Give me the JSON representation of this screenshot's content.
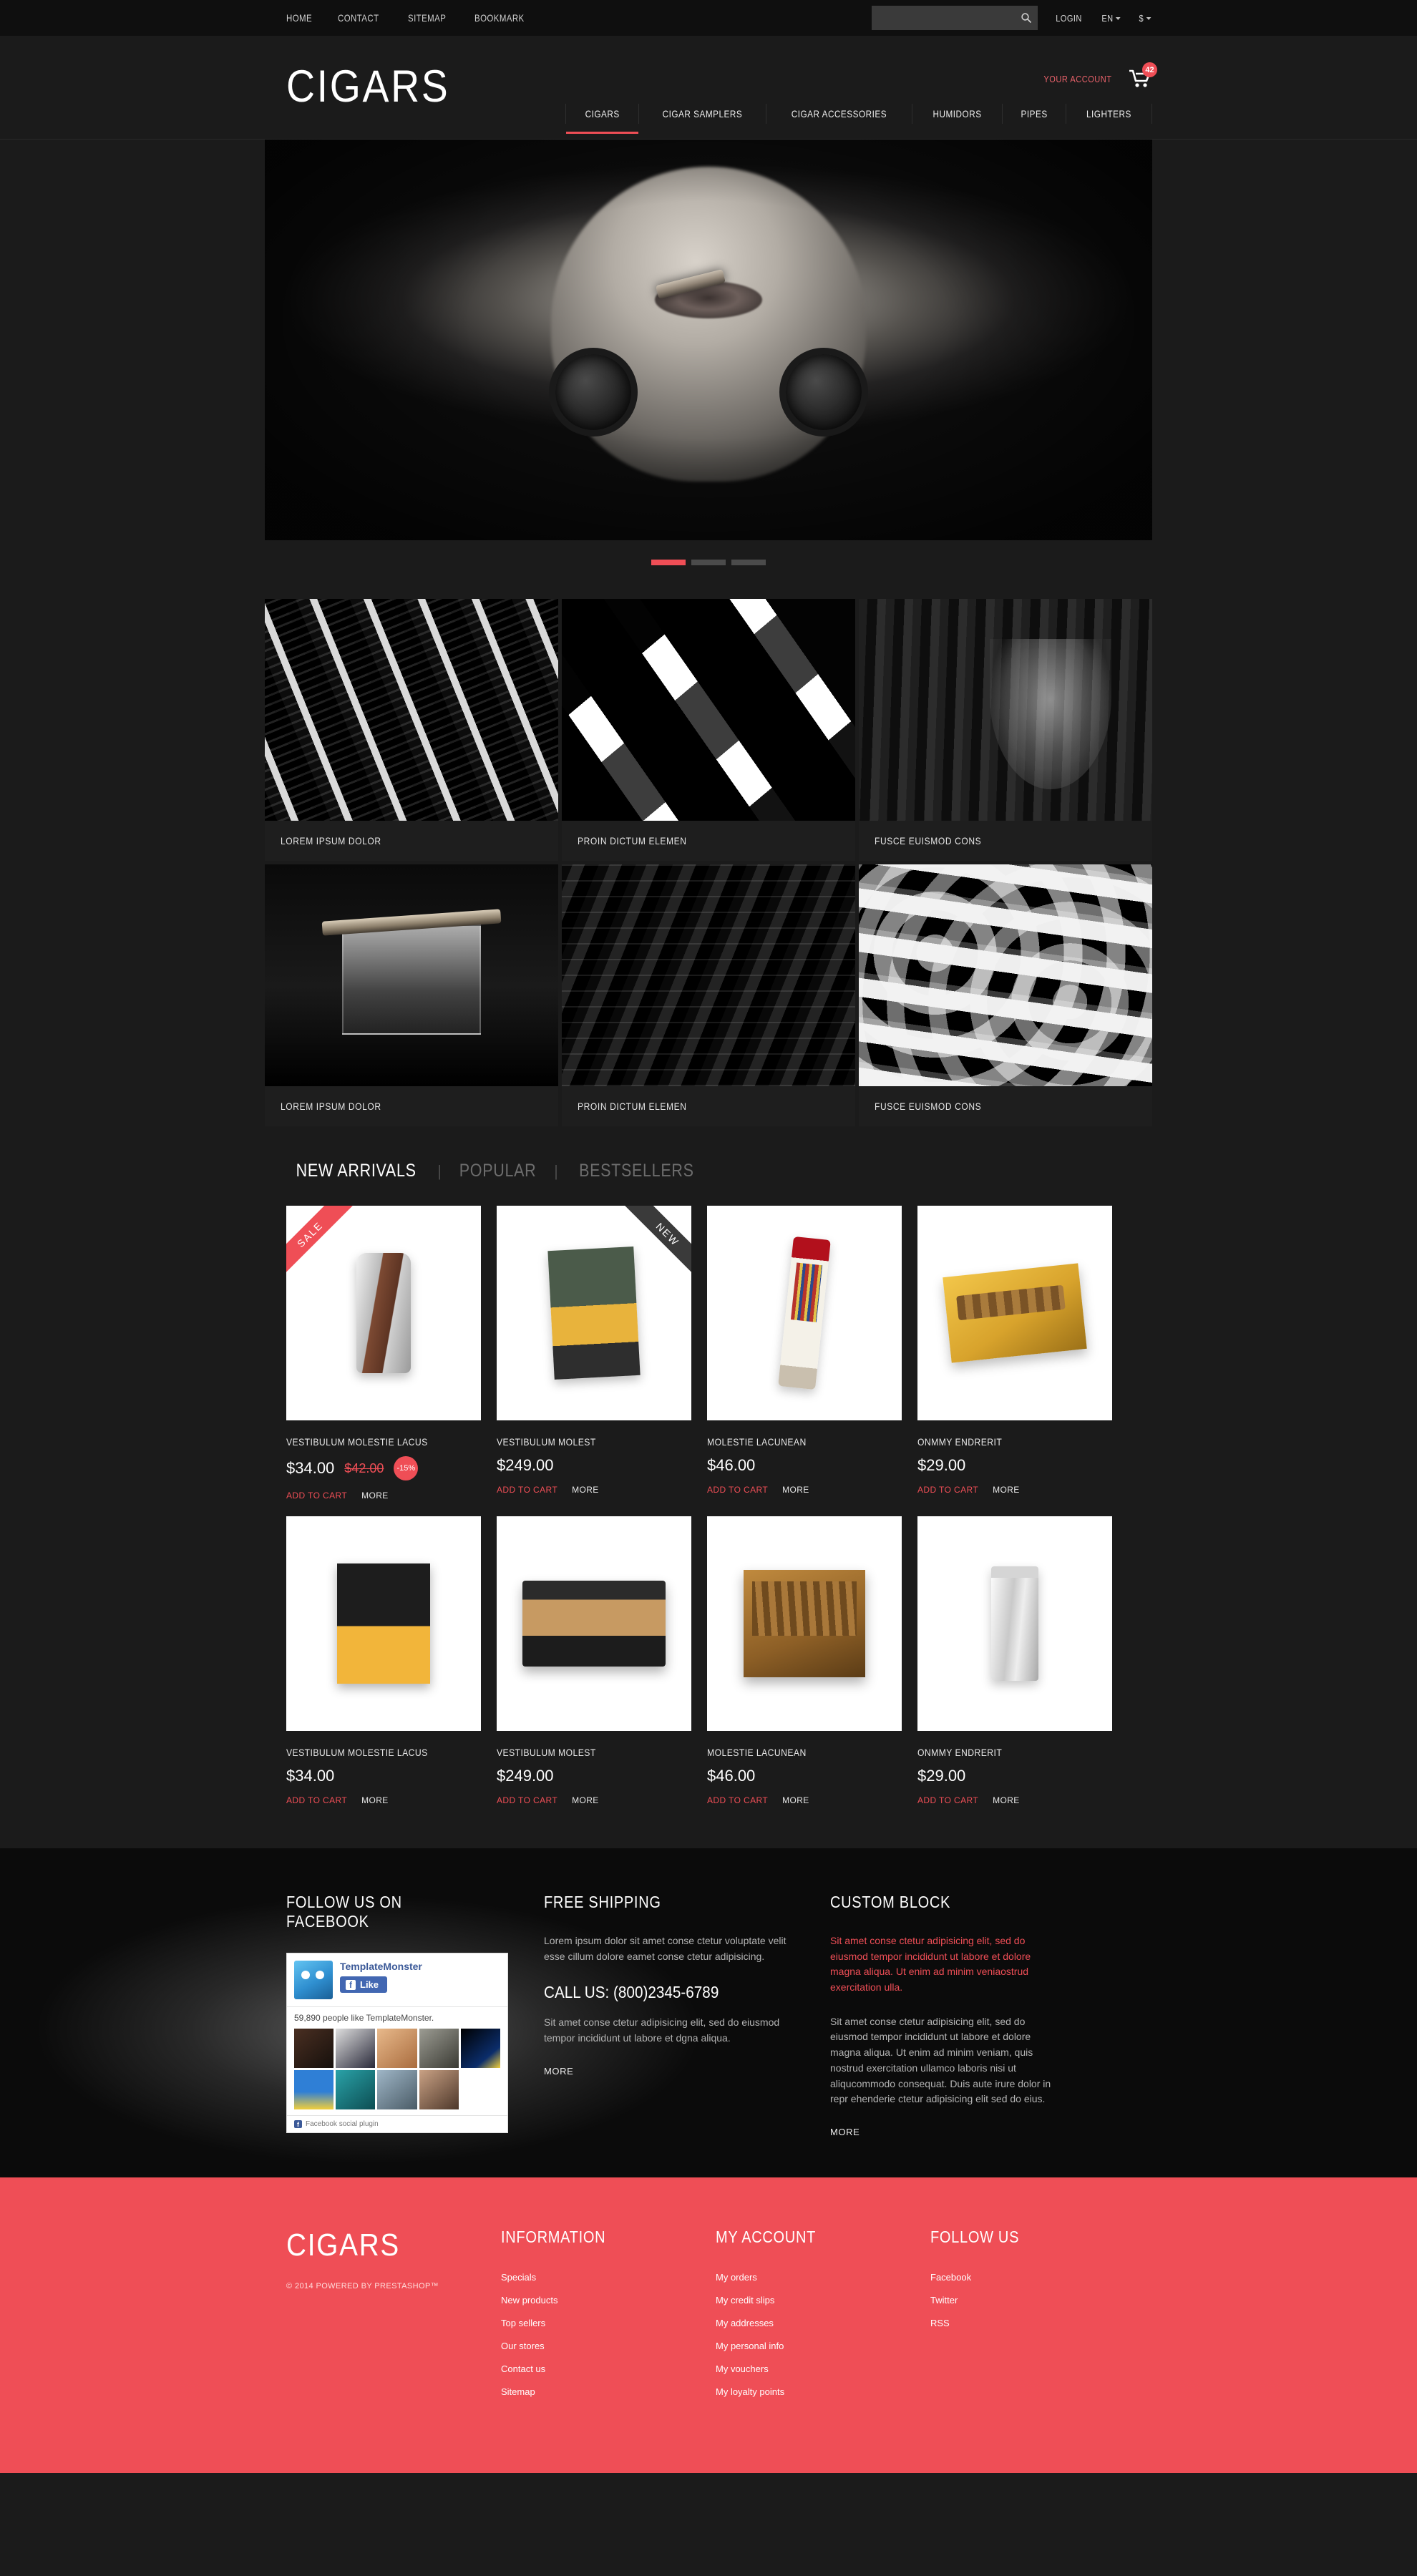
{
  "colors": {
    "accent": "#ef4e56",
    "dark": "#1b1b1b",
    "darker": "#0f0f0f"
  },
  "topbar": {
    "links": [
      "HOME",
      "CONTACT",
      "SITEMAP",
      "BOOKMARK"
    ],
    "search_placeholder": "",
    "search_value": "",
    "login_label": "LOGIN",
    "language_label": "EN",
    "currency_label": "$"
  },
  "header": {
    "logo": "CIGARS",
    "account_label": "YOUR ACCOUNT",
    "cart_count": "42",
    "nav": [
      {
        "label": "CIGARS",
        "active": true
      },
      {
        "label": "CIGAR SAMPLERS",
        "active": false
      },
      {
        "label": "CIGAR ACCESSORIES",
        "active": false
      },
      {
        "label": "HUMIDORS",
        "active": false
      },
      {
        "label": "PIPES",
        "active": false
      },
      {
        "label": "LIGHTERS",
        "active": false
      }
    ]
  },
  "slider": {
    "slides": 3,
    "active_index": 0
  },
  "categories": [
    {
      "caption": "LOREM IPSUM DOLOR",
      "art": "ph-bands"
    },
    {
      "caption": "PROIN DICTUM ELEMEN",
      "art": "ph-scatter"
    },
    {
      "caption": "FUSCE EUISMOD CONS",
      "art": "ph-glass"
    },
    {
      "caption": "LOREM IPSUM DOLOR",
      "art": "ph-whisky"
    },
    {
      "caption": "PROIN DICTUM ELEMEN",
      "art": "ph-smoke"
    },
    {
      "caption": "FUSCE EUISMOD CONS",
      "art": "ph-labels"
    }
  ],
  "products_section": {
    "tabs": [
      {
        "label": "NEW ARRIVALS",
        "active": true
      },
      {
        "label": "POPULAR",
        "active": false
      },
      {
        "label": "BESTSELLERS",
        "active": false
      }
    ],
    "separator": "|",
    "add_to_cart_label": "ADD TO CART",
    "more_label": "MORE",
    "items": [
      {
        "name": "VESTIBULUM MOLESTIE LACUS",
        "price": "$34.00",
        "old_price": "$42.00",
        "discount": "-15%",
        "badge": "SALE",
        "badge_side": "left",
        "art": "pp-lighter1"
      },
      {
        "name": "VESTIBULUM MOLEST",
        "price": "$249.00",
        "old_price": "",
        "discount": "",
        "badge": "NEW",
        "badge_side": "right",
        "art": "pp-box-green"
      },
      {
        "name": "MOLESTIE LACUNEAN",
        "price": "$46.00",
        "old_price": "",
        "discount": "",
        "badge": "",
        "badge_side": "",
        "art": "pp-tube"
      },
      {
        "name": "ONMMY ENDRERIT",
        "price": "$29.00",
        "old_price": "",
        "discount": "",
        "badge": "",
        "badge_side": "",
        "art": "pp-goldbox"
      },
      {
        "name": "VESTIBULUM MOLESTIE LACUS",
        "price": "$34.00",
        "old_price": "",
        "discount": "",
        "badge": "",
        "badge_side": "",
        "art": "pp-darkbox"
      },
      {
        "name": "VESTIBULUM MOLEST",
        "price": "$249.00",
        "old_price": "",
        "discount": "",
        "badge": "",
        "badge_side": "",
        "art": "pp-humidor"
      },
      {
        "name": "MOLESTIE LACUNEAN",
        "price": "$46.00",
        "old_price": "",
        "discount": "",
        "badge": "",
        "badge_side": "",
        "art": "pp-openbox"
      },
      {
        "name": "ONMMY ENDRERIT",
        "price": "$29.00",
        "old_price": "",
        "discount": "",
        "badge": "",
        "badge_side": "",
        "art": "pp-lighter2"
      }
    ]
  },
  "footer_dark": {
    "facebook": {
      "heading": "FOLLOW US ON FACEBOOK",
      "page_name": "TemplateMonster",
      "like_label": "Like",
      "count_text": "59,890 people like TemplateMonster.",
      "plugin_label": "Facebook social plugin"
    },
    "shipping": {
      "heading": "FREE SHIPPING",
      "paragraph": "Lorem ipsum dolor sit amet conse ctetur voluptate velit esse cillum dolore eamet conse ctetur adipisicing.",
      "call_heading": "CALL US: (800)2345-6789",
      "paragraph2": "Sit amet conse ctetur adipisicing elit, sed do eiusmod tempor incididunt ut labore et dgna aliqua.",
      "more_label": "MORE"
    },
    "custom": {
      "heading": "CUSTOM BLOCK",
      "paragraph_red": "Sit amet conse ctetur adipisicing elit, sed do eiusmod tempor incididunt ut labore et dolore magna aliqua. Ut enim ad minim veniaostrud exercitation ulla.",
      "paragraph_gray": "Sit amet conse ctetur adipisicing elit, sed do eiusmod tempor incididunt ut labore et dolore magna aliqua. Ut enim ad minim veniam, quis nostrud exercitation ullamco laboris nisi ut aliqucommodo consequat. Duis aute irure dolor in repr ehenderie ctetur adipisicing elit sed do eius.",
      "more_label": "MORE"
    }
  },
  "footer_red": {
    "logo": "CIGARS",
    "copyright": "© 2014 POWERED BY PRESTASHOP™",
    "columns": [
      {
        "heading": "INFORMATION",
        "links": [
          "Specials",
          "New products",
          "Top sellers",
          "Our stores",
          "Contact us",
          "Sitemap"
        ]
      },
      {
        "heading": "MY ACCOUNT",
        "links": [
          "My orders",
          "My credit slips",
          "My addresses",
          "My personal info",
          "My vouchers",
          "My loyalty points"
        ]
      },
      {
        "heading": "FOLLOW US",
        "links": [
          "Facebook",
          "Twitter",
          "RSS"
        ]
      }
    ]
  }
}
